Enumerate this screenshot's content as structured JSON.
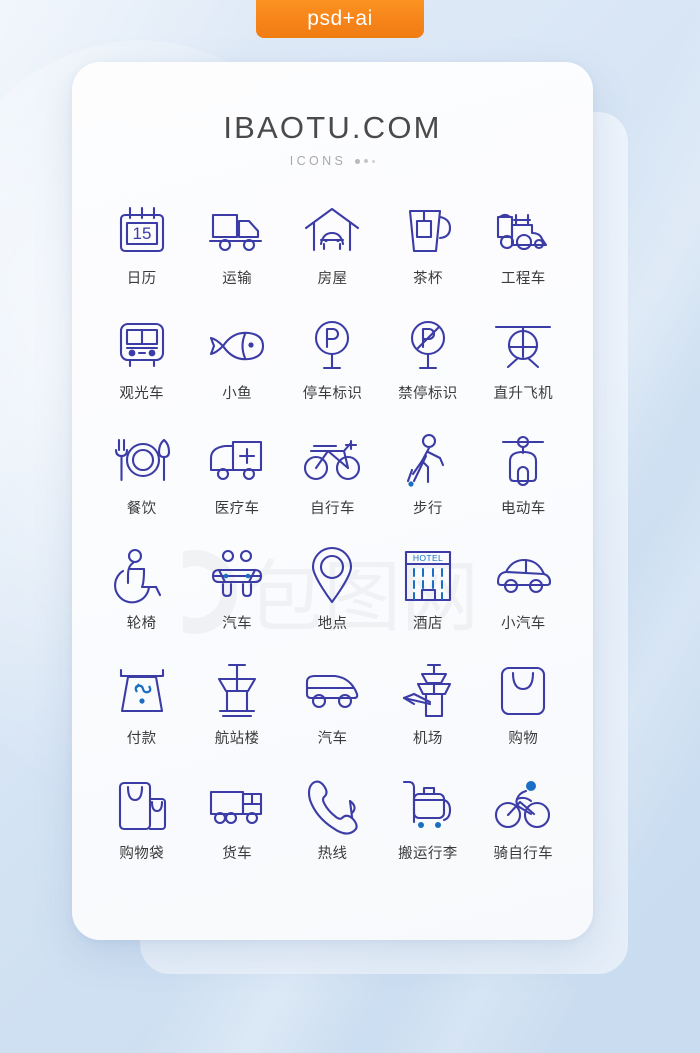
{
  "badge": {
    "label": "psd+ai"
  },
  "header": {
    "title": "IBAOTU.COM",
    "subtitle": "ICONS"
  },
  "colors": {
    "icon_stroke": "#3c3ca6",
    "icon_accent": "#1a6fc4",
    "label_text": "#3b3b3b",
    "badge_orange": "#f6841a",
    "title_gray": "#4a4a4a",
    "subtitle_gray": "#a9a9a9",
    "card_bg": "#fbfcfe",
    "page_bg": "#d7e6f5"
  },
  "grid": {
    "columns": 5,
    "rows": 6,
    "icons": [
      {
        "id": "calendar",
        "icon": "calendar-icon",
        "label": "日历",
        "value": "15"
      },
      {
        "id": "transport",
        "icon": "truck-icon",
        "label": "运输"
      },
      {
        "id": "house",
        "icon": "garage-house-icon",
        "label": "房屋"
      },
      {
        "id": "teacup",
        "icon": "teacup-icon",
        "label": "茶杯"
      },
      {
        "id": "engineering-car",
        "icon": "locomotive-icon",
        "label": "工程车"
      },
      {
        "id": "sightseeing-bus",
        "icon": "tram-icon",
        "label": "观光车"
      },
      {
        "id": "small-fish",
        "icon": "fish-icon",
        "label": "小鱼"
      },
      {
        "id": "parking-sign",
        "icon": "parking-sign-icon",
        "label": "停车标识"
      },
      {
        "id": "no-parking-sign",
        "icon": "no-parking-sign-icon",
        "label": "禁停标识"
      },
      {
        "id": "helicopter",
        "icon": "helicopter-icon",
        "label": "直升飞机"
      },
      {
        "id": "dining",
        "icon": "cutlery-plate-icon",
        "label": "餐饮"
      },
      {
        "id": "ambulance",
        "icon": "ambulance-icon",
        "label": "医疗车"
      },
      {
        "id": "bicycle",
        "icon": "bicycle-icon",
        "label": "自行车"
      },
      {
        "id": "walking",
        "icon": "walking-person-icon",
        "label": "步行"
      },
      {
        "id": "electric-scooter",
        "icon": "scooter-front-icon",
        "label": "电动车"
      },
      {
        "id": "wheelchair",
        "icon": "wheelchair-icon",
        "label": "轮椅"
      },
      {
        "id": "car-top",
        "icon": "car-top-view-icon",
        "label": "汽车"
      },
      {
        "id": "location",
        "icon": "map-pin-icon",
        "label": "地点"
      },
      {
        "id": "hotel",
        "icon": "hotel-building-icon",
        "label": "酒店",
        "value": "HOTEL"
      },
      {
        "id": "small-car",
        "icon": "car-side-icon",
        "label": "小汽车"
      },
      {
        "id": "payment",
        "icon": "atm-payment-icon",
        "label": "付款"
      },
      {
        "id": "terminal",
        "icon": "control-tower-icon",
        "label": "航站楼"
      },
      {
        "id": "van",
        "icon": "van-icon",
        "label": "汽车"
      },
      {
        "id": "airport",
        "icon": "airport-tower-icon",
        "label": "机场"
      },
      {
        "id": "shopping",
        "icon": "shopping-bag-icon",
        "label": "购物"
      },
      {
        "id": "shopping-bags",
        "icon": "two-bags-icon",
        "label": "购物袋"
      },
      {
        "id": "freight-truck",
        "icon": "cargo-truck-icon",
        "label": "货车"
      },
      {
        "id": "hotline",
        "icon": "telephone-handset-icon",
        "label": "热线"
      },
      {
        "id": "luggage-cart",
        "icon": "luggage-cart-icon",
        "label": "搬运行李"
      },
      {
        "id": "ride-bicycle",
        "icon": "cyclist-icon",
        "label": "骑自行车"
      }
    ]
  }
}
